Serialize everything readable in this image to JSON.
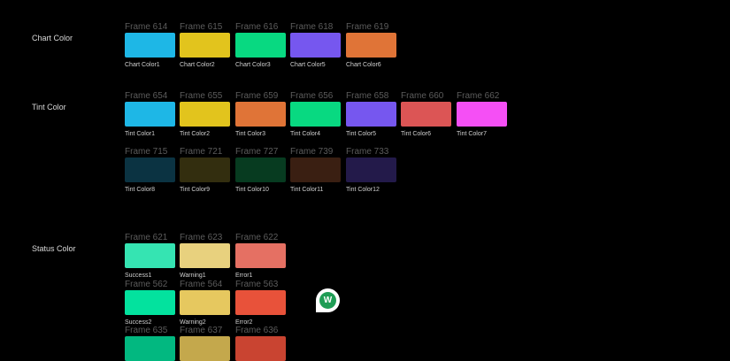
{
  "sections": [
    {
      "label": "Chart Color"
    },
    {
      "label": "Tint Color"
    },
    {
      "label": "Status Color"
    }
  ],
  "chart_colors": [
    {
      "frame": "Frame 614",
      "name": "Chart Color1",
      "color": "#1eb7e6"
    },
    {
      "frame": "Frame 615",
      "name": "Chart Color2",
      "color": "#e2c41d"
    },
    {
      "frame": "Frame 616",
      "name": "Chart Color3",
      "color": "#08d981"
    },
    {
      "frame": "Frame 618",
      "name": "Chart Color5",
      "color": "#7657ef"
    },
    {
      "frame": "Frame 619",
      "name": "Chart Color6",
      "color": "#e07437"
    }
  ],
  "tint_colors_row1": [
    {
      "frame": "Frame 654",
      "name": "Tint Color1",
      "color": "#1eb7e6"
    },
    {
      "frame": "Frame 655",
      "name": "Tint Color2",
      "color": "#e2c41d"
    },
    {
      "frame": "Frame 659",
      "name": "Tint Color3",
      "color": "#e07437"
    },
    {
      "frame": "Frame 656",
      "name": "Tint Color4",
      "color": "#08d981"
    },
    {
      "frame": "Frame 658",
      "name": "Tint Color5",
      "color": "#7657ef"
    },
    {
      "frame": "Frame 660",
      "name": "Tint Color6",
      "color": "#dc5555"
    },
    {
      "frame": "Frame 662",
      "name": "Tint Color7",
      "color": "#f54ff5"
    }
  ],
  "tint_colors_row2": [
    {
      "frame": "Frame 715",
      "name": "Tint Color8",
      "color": "#0b3342"
    },
    {
      "frame": "Frame 721",
      "name": "Tint Color9",
      "color": "#332e0f"
    },
    {
      "frame": "Frame 727",
      "name": "Tint Color10",
      "color": "#073b20"
    },
    {
      "frame": "Frame 739",
      "name": "Tint Color11",
      "color": "#3a1f12"
    },
    {
      "frame": "Frame 733",
      "name": "Tint Color12",
      "color": "#231a4a"
    }
  ],
  "status_colors_row1": [
    {
      "frame": "Frame 621",
      "name": "Success1",
      "color": "#35e4b2"
    },
    {
      "frame": "Frame 623",
      "name": "Warning1",
      "color": "#e8d17e"
    },
    {
      "frame": "Frame 622",
      "name": "Error1",
      "color": "#e57063"
    }
  ],
  "status_colors_row2": [
    {
      "frame": "Frame 562",
      "name": "Success2",
      "color": "#03e29e"
    },
    {
      "frame": "Frame 564",
      "name": "Warning2",
      "color": "#e6c85f"
    },
    {
      "frame": "Frame 563",
      "name": "Error2",
      "color": "#e8523a"
    }
  ],
  "status_colors_row3": [
    {
      "frame": "Frame 635",
      "color": "#02b880"
    },
    {
      "frame": "Frame 637",
      "color": "#c4a84c"
    },
    {
      "frame": "Frame 636",
      "color": "#c94431"
    }
  ],
  "avatar": {
    "initial": "W",
    "color": "#1f9d55"
  }
}
